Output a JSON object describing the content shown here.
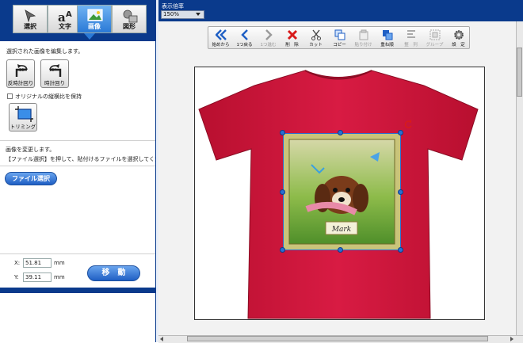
{
  "left_panel": {
    "tabs": [
      {
        "label": "選択",
        "icon": "cursor-icon"
      },
      {
        "label": "文字",
        "icon": "text-icon"
      },
      {
        "label": "画像",
        "icon": "image-icon",
        "active": true
      },
      {
        "label": "図形",
        "icon": "shapes-icon"
      }
    ],
    "image_edit_text": "選択された画像を編集します。",
    "rotate_ccw_label": "反時計回り",
    "rotate_cw_label": "時計回り",
    "rotate_badge": "90°",
    "keep_ratio_label": "オリジナルの縦横比を保持",
    "trimming_label": "トリミング",
    "change_text_1": "画像を変更します。",
    "change_text_2": "【ファイル選択】を押して、貼付けるファイルを選択してください。",
    "file_select_label": "ファイル選択",
    "x_label": "X:",
    "x_value": "51.81",
    "y_label": "Y:",
    "y_value": "39.11",
    "unit": "mm",
    "move_label": "移　動"
  },
  "header": {
    "zoom_title": "表示倍率",
    "zoom_value": "150%"
  },
  "toolbar": [
    {
      "label": "始めから",
      "icon": "double-left-icon",
      "enabled": true
    },
    {
      "label": "1つ戻る",
      "icon": "left-icon",
      "enabled": true
    },
    {
      "label": "1つ進む",
      "icon": "right-icon",
      "enabled": false
    },
    {
      "label": "削　除",
      "icon": "delete-icon",
      "enabled": true
    },
    {
      "label": "カット",
      "icon": "scissors-icon",
      "enabled": true
    },
    {
      "label": "コピー",
      "icon": "copy-icon",
      "enabled": true
    },
    {
      "label": "貼り付け",
      "icon": "paste-icon",
      "enabled": false
    },
    {
      "label": "重ね順",
      "icon": "layers-icon",
      "enabled": true
    },
    {
      "label": "整　列",
      "icon": "align-icon",
      "enabled": false
    },
    {
      "label": "グループ",
      "icon": "group-icon",
      "enabled": false
    },
    {
      "label": "設　定",
      "icon": "gear-icon",
      "enabled": true
    }
  ],
  "canvas": {
    "shirt_color": "#d4173d",
    "photo_caption": "Mark"
  },
  "colors": {
    "header_blue": "#0a3a8c",
    "accent_blue": "#2a79d6"
  }
}
